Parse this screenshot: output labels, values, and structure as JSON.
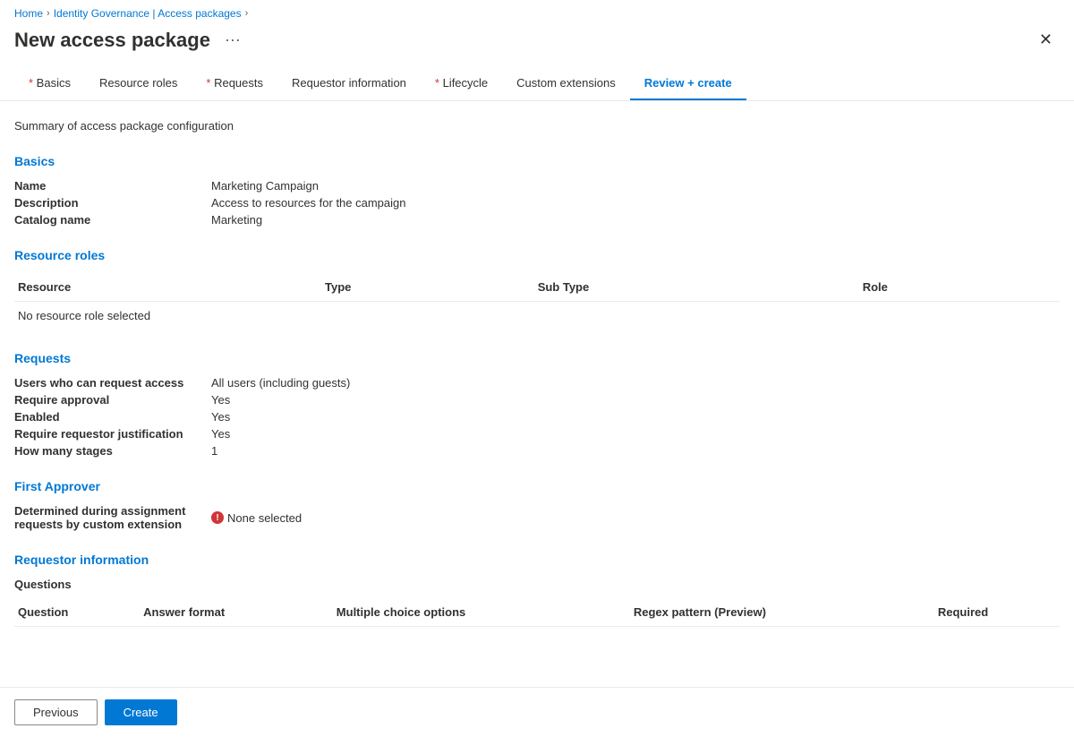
{
  "breadcrumb": {
    "items": [
      {
        "label": "Home",
        "link": true
      },
      {
        "label": "Identity Governance | Access packages",
        "link": true
      }
    ],
    "current": "New access package"
  },
  "page": {
    "title": "New access package",
    "ellipsis_label": "···",
    "close_label": "✕"
  },
  "tabs": [
    {
      "label": "Basics",
      "required": true,
      "active": false
    },
    {
      "label": "Resource roles",
      "required": false,
      "active": false
    },
    {
      "label": "Requests",
      "required": true,
      "active": false
    },
    {
      "label": "Requestor information",
      "required": false,
      "active": false
    },
    {
      "label": "Lifecycle",
      "required": true,
      "active": false
    },
    {
      "label": "Custom extensions",
      "required": false,
      "active": false
    },
    {
      "label": "Review + create",
      "required": false,
      "active": true
    }
  ],
  "summary": {
    "description": "Summary of access package configuration"
  },
  "basics_section": {
    "title": "Basics",
    "fields": [
      {
        "label": "Name",
        "value": "Marketing Campaign"
      },
      {
        "label": "Description",
        "value": "Access to resources for the campaign"
      },
      {
        "label": "Catalog name",
        "value": "Marketing"
      }
    ]
  },
  "resource_roles_section": {
    "title": "Resource roles",
    "columns": [
      "Resource",
      "Type",
      "Sub Type",
      "Role"
    ],
    "empty_message": "No resource role selected"
  },
  "requests_section": {
    "title": "Requests",
    "fields": [
      {
        "label": "Users who can request access",
        "value": "All users (including guests)"
      },
      {
        "label": "Require approval",
        "value": "Yes"
      },
      {
        "label": "Enabled",
        "value": "Yes"
      },
      {
        "label": "Require requestor justification",
        "value": "Yes"
      },
      {
        "label": "How many stages",
        "value": "1"
      }
    ]
  },
  "first_approver_section": {
    "title": "First Approver",
    "fields": [
      {
        "label": "Determined during assignment requests by custom extension",
        "value": "None selected",
        "has_error": true
      }
    ]
  },
  "requestor_info_section": {
    "title": "Requestor information",
    "questions_label": "Questions",
    "columns": [
      "Question",
      "Answer format",
      "Multiple choice options",
      "Regex pattern (Preview)",
      "Required"
    ]
  },
  "footer": {
    "previous_label": "Previous",
    "create_label": "Create"
  },
  "colors": {
    "accent": "#0078d4",
    "error": "#d13438"
  }
}
